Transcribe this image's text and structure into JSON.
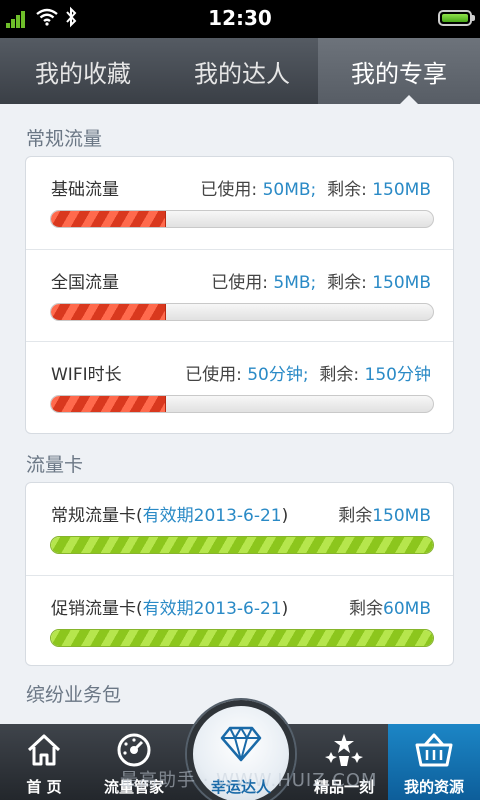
{
  "status_bar": {
    "time": "12:30"
  },
  "tabs": [
    {
      "label": "我的收藏"
    },
    {
      "label": "我的达人"
    },
    {
      "label": "我的专享"
    }
  ],
  "sections": {
    "regular_traffic": {
      "title": "常规流量",
      "rows": [
        {
          "label": "基础流量",
          "used_prefix": "已使用: ",
          "used": "50MB;",
          "remain_prefix": "剩余: ",
          "remain": "150MB",
          "progress": 0.3
        },
        {
          "label": "全国流量",
          "used_prefix": "已使用: ",
          "used": "5MB;",
          "remain_prefix": "剩余: ",
          "remain": "150MB",
          "progress": 0.3
        },
        {
          "label": "WIFI时长",
          "used_prefix": "已使用: ",
          "used": "50分钟;",
          "remain_prefix": "剩余: ",
          "remain": "150分钟",
          "progress": 0.3
        }
      ]
    },
    "traffic_cards": {
      "title": "流量卡",
      "rows": [
        {
          "label": "常规流量卡",
          "paren_open": "(",
          "validity": "有效期2013-6-21",
          "paren_close": ")",
          "remain_prefix": "剩余",
          "remain": "150MB",
          "progress": 1.0
        },
        {
          "label": "促销流量卡",
          "paren_open": "(",
          "validity": "有效期2013-6-21",
          "paren_close": ")",
          "remain_prefix": "剩余",
          "remain": "60MB",
          "progress": 1.0
        }
      ]
    },
    "service_packs": {
      "title": "缤纷业务包"
    }
  },
  "bottom_nav": {
    "home": "首 页",
    "traffic_manager": "流量管家",
    "lucky_expert": "幸运达人",
    "highlight": "精品一刻",
    "my_resources": "我的资源"
  },
  "watermark": "最高助手 · WWW.HUIZ.COM",
  "colors": {
    "accent_blue": "#2a8ac6",
    "progress_red": "#e8452a",
    "progress_green": "#9ad12f",
    "active_nav": "#1577b5"
  }
}
